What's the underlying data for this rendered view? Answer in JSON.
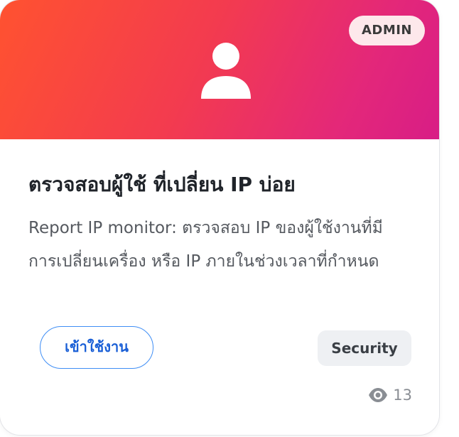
{
  "card": {
    "badge": "ADMIN",
    "header_icon": "user-icon",
    "title": "ตรวจสอบผู้ใช้ ที่เปลี่ยน IP บ่อย",
    "description": "Report IP monitor: ตรวจสอบ IP ของผู้ใช้งานที่มีการเปลี่ยนเครื่อง หรือ IP ภายในช่วงเวลาที่กำหนด",
    "button_label": "เข้าใช้งาน",
    "tag": "Security",
    "views_icon": "eye-icon",
    "views": "13"
  },
  "colors": {
    "header_gradient_start": "#ff5230",
    "header_gradient_end": "#d81d86",
    "badge_bg": "#fde8eb",
    "button_border": "#3f8ef5",
    "button_text": "#1a5fd6",
    "tag_bg": "#eef0f3"
  }
}
